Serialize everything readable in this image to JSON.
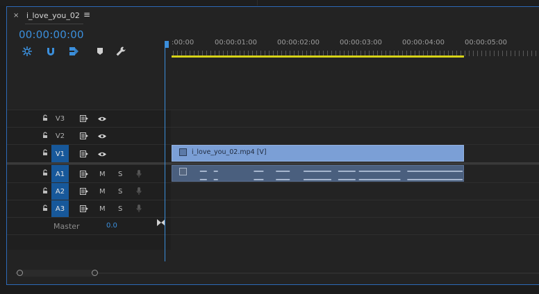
{
  "sequence": {
    "title": "i_love_you_02",
    "close_glyph": "×",
    "menu_glyph": "≡",
    "timecode": "00:00:00:00"
  },
  "toolbar": {
    "tools": [
      "snap-icon",
      "magnet-icon",
      "linked-selection-icon",
      "add-marker-icon",
      "wrench-icon"
    ]
  },
  "ruler": {
    "labels": [
      ":00:00",
      "00:00:01:00",
      "00:00:02:00",
      "00:00:03:00",
      "00:00:04:00",
      "00:00:05:00"
    ]
  },
  "tracks": {
    "v3": {
      "name": "V3",
      "active": false
    },
    "v2": {
      "name": "V2",
      "active": false
    },
    "v1": {
      "name": "V1",
      "active": true
    },
    "a1": {
      "name": "A1",
      "active": true,
      "m": "M",
      "s": "S"
    },
    "a2": {
      "name": "A2",
      "active": true,
      "m": "M",
      "s": "S"
    },
    "a3": {
      "name": "A3",
      "active": true,
      "m": "M",
      "s": "S"
    }
  },
  "master": {
    "label": "Master",
    "value": "0.0"
  },
  "clips": {
    "video_label": "i_love_you_02.mp4 [V]"
  },
  "colors": {
    "accent": "#3b8fdc",
    "video_clip": "#7b9fd6",
    "audio_clip": "#4a5f7e",
    "work_area": "#d7d317",
    "active_track": "#17589a"
  }
}
